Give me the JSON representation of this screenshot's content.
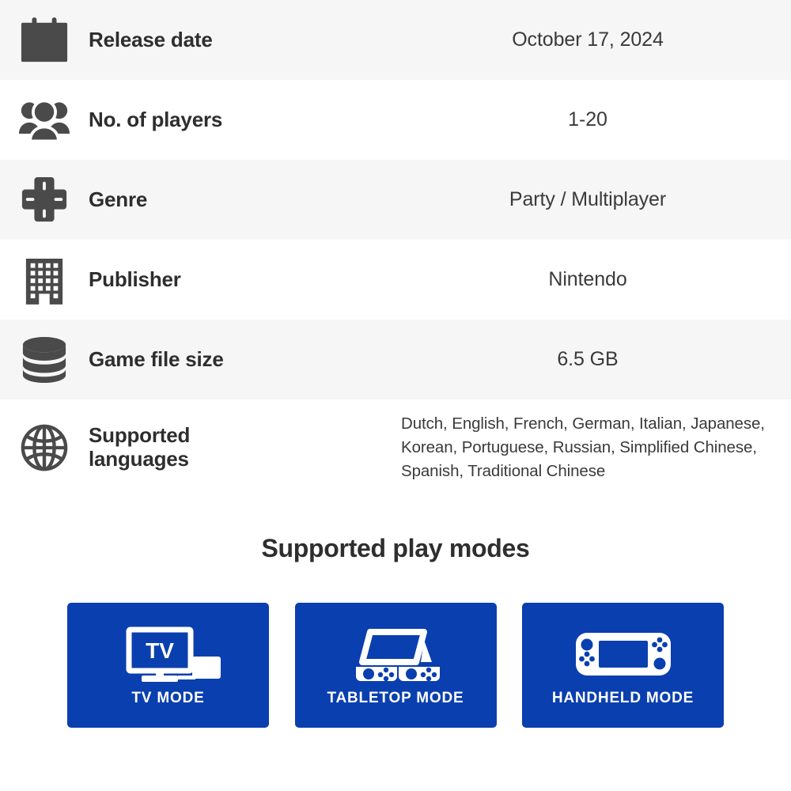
{
  "spec_rows": [
    {
      "icon": "calendar-icon",
      "label": "Release date",
      "value": "October 17, 2024"
    },
    {
      "icon": "players-icon",
      "label": "No. of players",
      "value": "1-20"
    },
    {
      "icon": "dpad-icon",
      "label": "Genre",
      "value": "Party / Multiplayer"
    },
    {
      "icon": "building-icon",
      "label": "Publisher",
      "value": "Nintendo"
    },
    {
      "icon": "database-icon",
      "label": "Game file size",
      "value": "6.5 GB"
    },
    {
      "icon": "globe-icon",
      "label": "Supported languages",
      "value": "Dutch, English, French, German, Italian, Japanese, Korean, Portuguese, Russian, Simplified Chinese, Spanish, Traditional Chinese"
    }
  ],
  "play_modes": {
    "title": "Supported play modes",
    "cards": [
      {
        "icon": "tv-mode-icon",
        "label": "TV MODE",
        "screen_text": "TV"
      },
      {
        "icon": "tabletop-mode-icon",
        "label": "TABLETOP MODE"
      },
      {
        "icon": "handheld-mode-icon",
        "label": "HANDHELD MODE"
      }
    ]
  },
  "colors": {
    "card_blue": "#0A3FAF",
    "row_alt_background": "#F6F6F6",
    "row_background": "#FFFFFF",
    "icon_gray": "#4A4A4A",
    "label_text": "#2E2E2E",
    "value_text": "#3A3A3A",
    "card_text": "#FFFFFF"
  }
}
